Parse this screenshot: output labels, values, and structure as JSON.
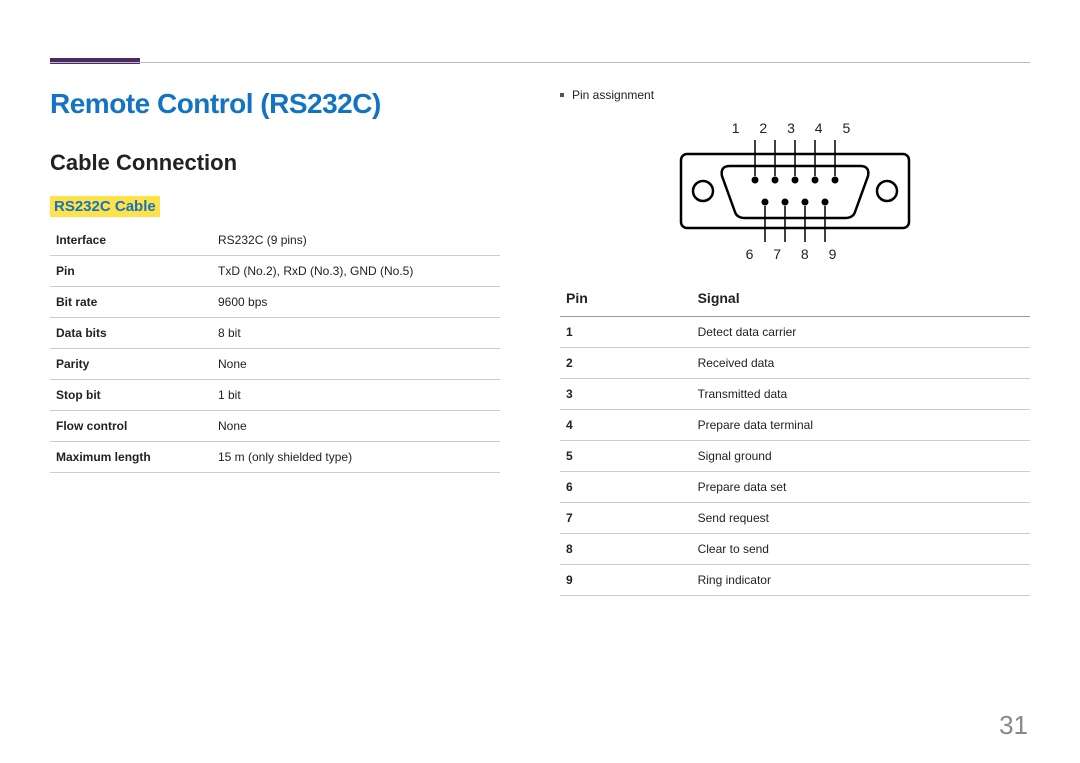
{
  "title": "Remote Control (RS232C)",
  "section": "Cable Connection",
  "cable_heading": "RS232C Cable",
  "spec": {
    "rows": [
      {
        "k": "Interface",
        "v": "RS232C (9 pins)"
      },
      {
        "k": "Pin",
        "v": "TxD (No.2), RxD (No.3), GND (No.5)"
      },
      {
        "k": "Bit rate",
        "v": "9600 bps"
      },
      {
        "k": "Data bits",
        "v": "8 bit"
      },
      {
        "k": "Parity",
        "v": "None"
      },
      {
        "k": "Stop bit",
        "v": "1 bit"
      },
      {
        "k": "Flow control",
        "v": "None"
      },
      {
        "k": "Maximum length",
        "v": "15 m (only shielded type)"
      }
    ]
  },
  "pin_assignment_label": "Pin assignment",
  "pin_labels_top": "1   2   3   4   5",
  "pin_labels_bottom": "6   7   8   9",
  "signal_table": {
    "head_pin": "Pin",
    "head_signal": "Signal",
    "rows": [
      {
        "p": "1",
        "s": "Detect data carrier"
      },
      {
        "p": "2",
        "s": "Received data"
      },
      {
        "p": "3",
        "s": "Transmitted data"
      },
      {
        "p": "4",
        "s": "Prepare data terminal"
      },
      {
        "p": "5",
        "s": "Signal ground"
      },
      {
        "p": "6",
        "s": "Prepare data set"
      },
      {
        "p": "7",
        "s": "Send request"
      },
      {
        "p": "8",
        "s": "Clear to send"
      },
      {
        "p": "9",
        "s": "Ring indicator"
      }
    ]
  },
  "page_number": "31"
}
